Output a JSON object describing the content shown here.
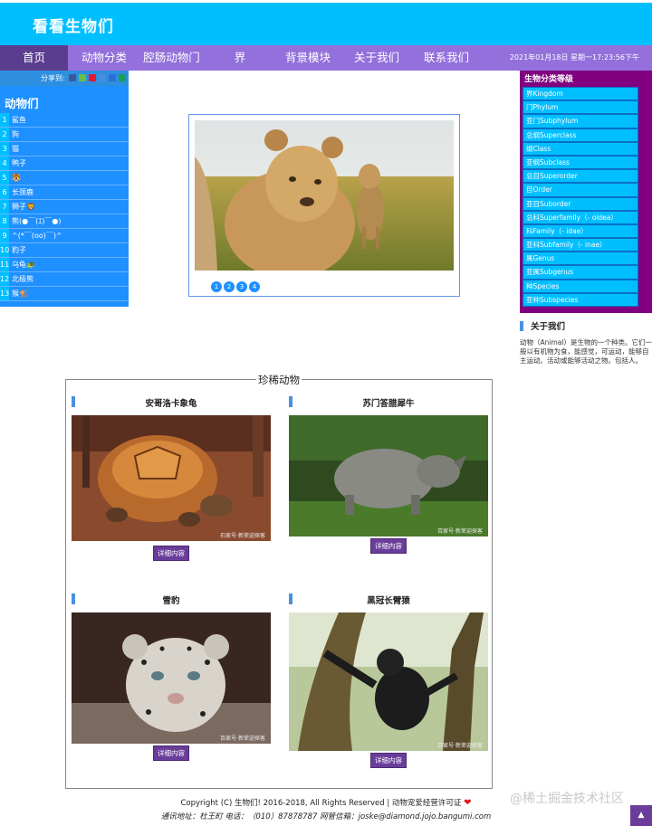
{
  "header": {
    "title": "看看生物们"
  },
  "nav": {
    "items": [
      "首页",
      "动物分类",
      "腔肠动物门",
      "界",
      "背景模块",
      "关于我们",
      "联系我们"
    ],
    "datetime": "2021年01月18日 星期一17:23:56下午"
  },
  "share": {
    "label": "分享到:"
  },
  "left": {
    "title": "动物们",
    "animals": [
      {
        "n": "1",
        "name": "鲨鱼"
      },
      {
        "n": "2",
        "name": "狗"
      },
      {
        "n": "3",
        "name": "猫"
      },
      {
        "n": "4",
        "name": "鸭子"
      },
      {
        "n": "5",
        "name": "🐯"
      },
      {
        "n": "6",
        "name": "长颈鹿"
      },
      {
        "n": "7",
        "name": "狮子🦁"
      },
      {
        "n": "8",
        "name": "熊(●￣(ｴ)￣●)"
      },
      {
        "n": "9",
        "name": "^(*￣(oo)￣)^"
      },
      {
        "n": "10",
        "name": "豹子"
      },
      {
        "n": "11",
        "name": "乌龟🐢"
      },
      {
        "n": "12",
        "name": "北极熊"
      },
      {
        "n": "13",
        "name": "猴🐒"
      }
    ]
  },
  "slider": {
    "dots": [
      "1",
      "2",
      "3",
      "4"
    ]
  },
  "classification": {
    "title": "生物分类等级",
    "items": [
      "界Kingdom",
      "门Phylum",
      "亚门Subphylum",
      "总纲Superclass",
      "纲Class",
      "亚纲Subclass",
      "总目Superorder",
      "目Order",
      "亚目Suborder",
      "总科Superfamily（- oidea）",
      "科Family（- idae）",
      "亚科Subfamily（- inae）",
      "属Genus",
      "亚属Subgenus",
      "种Species",
      "亚种Subspecies"
    ]
  },
  "about": {
    "title": "关于我们",
    "text": "动物（Animal）是生物的一个种类。它们一般以有机物为食，能感觉，可运动，能够自主运动。活动或能够活动之物。包括人。"
  },
  "rare": {
    "title": "珍稀动物",
    "cards": [
      {
        "title": "安哥洛卡象龟",
        "button": "详细内容",
        "credit": "石家号·新荣迎探客"
      },
      {
        "title": "苏门答腊犀牛",
        "button": "详细内容",
        "credit": "百家号·新荣迎探客"
      },
      {
        "title": "雪豹",
        "button": "详细内容",
        "credit": "百家号·新荣迎探客"
      },
      {
        "title": "黑冠长臂猿",
        "button": "详细内容",
        "credit": "百家号·新荣迎探客"
      }
    ]
  },
  "footer": {
    "line1": "Copyright (C) 生物们!   2016-2018, All Rights Reserved | 动物宠爱经营许可证",
    "line2": "通讯地址：杜王町   电话：（010）87878787   网管信箱：joske@diamond.jojo.bangumi.com"
  },
  "watermark": "@稀土掘金技术社区",
  "to_top": "▲"
}
